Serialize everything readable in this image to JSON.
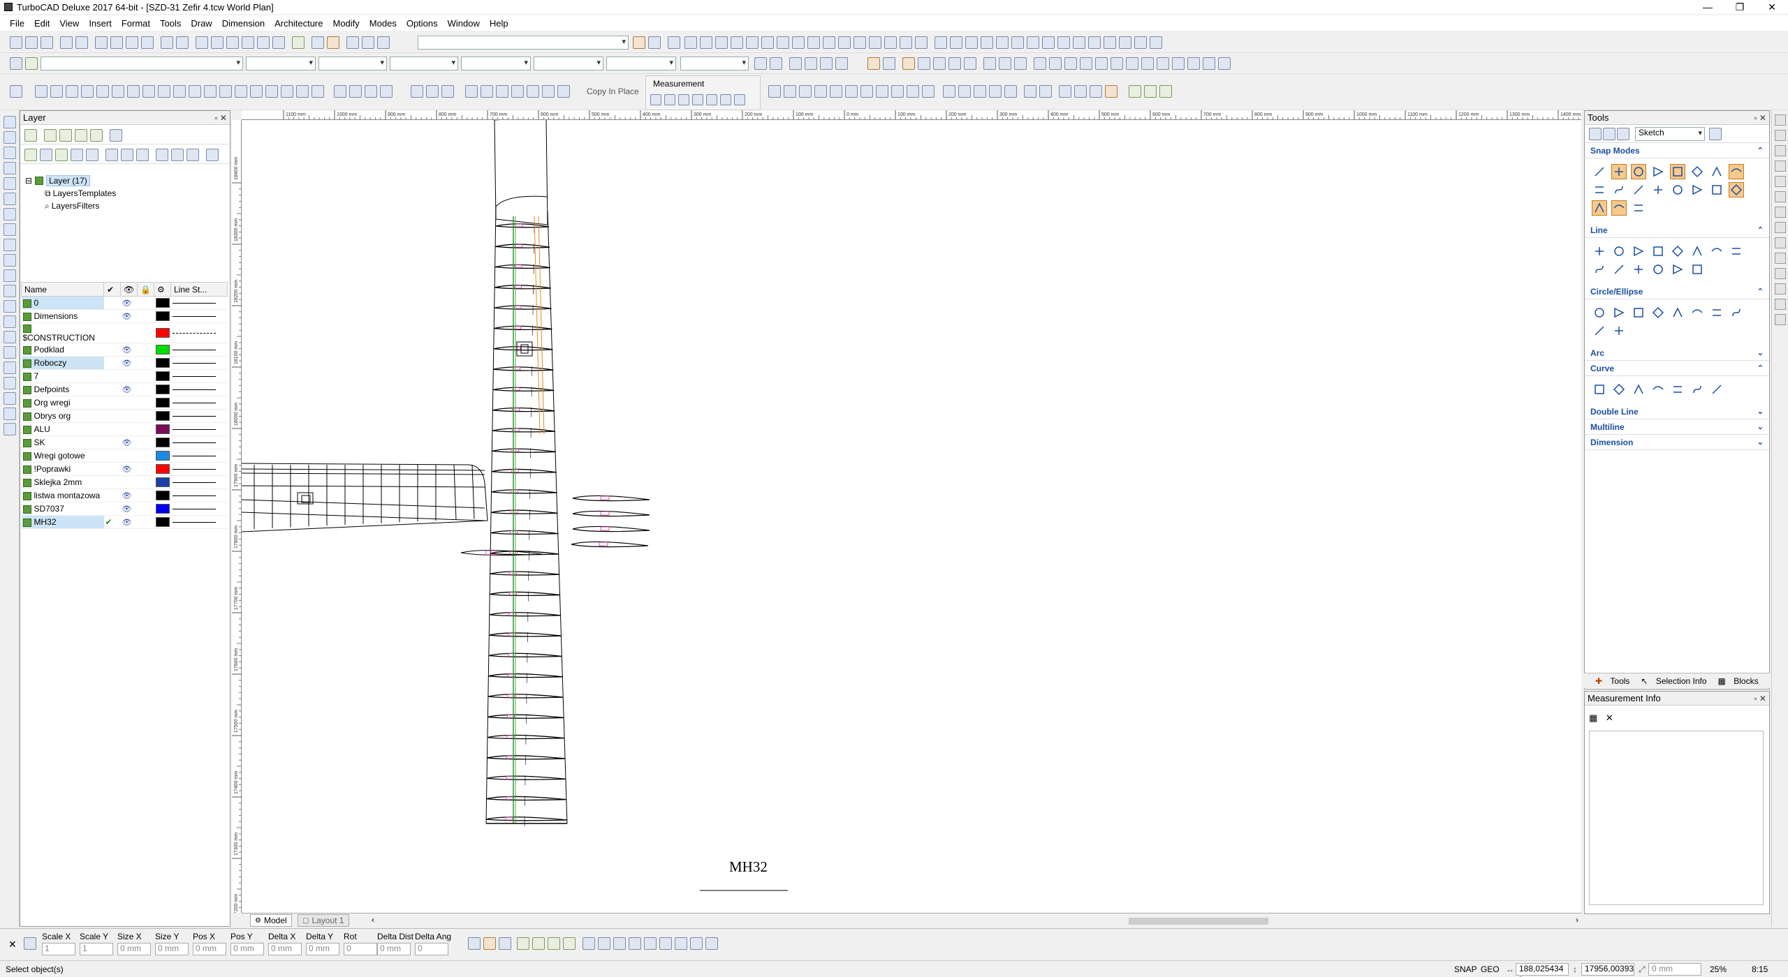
{
  "window": {
    "title": "TurboCAD Deluxe 2017 64-bit - [SZD-31 Zefir 4.tcw World Plan]",
    "controls": [
      "—",
      "❐",
      "✕"
    ]
  },
  "menu": [
    "File",
    "Edit",
    "View",
    "Insert",
    "Format",
    "Tools",
    "Draw",
    "Dimension",
    "Architecture",
    "Modify",
    "Modes",
    "Options",
    "Window",
    "Help"
  ],
  "toolbars": {
    "copy_in_place": "Copy In Place",
    "measurement_group": "Measurement"
  },
  "layer_panel": {
    "title": "Layer",
    "tree": {
      "root": "Layer (17)",
      "children": [
        "LayersTemplates",
        "LayersFilters"
      ]
    },
    "columns": [
      "Name",
      "✔",
      "👁",
      "🔒",
      "⚙",
      "Line St..."
    ],
    "layers": [
      {
        "name": "0",
        "visible": true,
        "active": false,
        "selected": true,
        "color": "#000000",
        "line": "solid"
      },
      {
        "name": "Dimensions",
        "visible": true,
        "active": false,
        "selected": false,
        "color": "#000000",
        "line": "solid"
      },
      {
        "name": "$CONSTRUCTION",
        "visible": false,
        "active": false,
        "selected": false,
        "color": "#ff0000",
        "line": "dash"
      },
      {
        "name": "Podklad",
        "visible": true,
        "active": false,
        "selected": false,
        "color": "#00dd00",
        "line": "solid"
      },
      {
        "name": "Roboczy",
        "visible": true,
        "active": false,
        "selected": true,
        "color": "#000000",
        "line": "solid"
      },
      {
        "name": "7",
        "visible": false,
        "active": false,
        "selected": false,
        "color": "#000000",
        "line": "solid"
      },
      {
        "name": "Defpoints",
        "visible": true,
        "active": false,
        "selected": false,
        "color": "#000000",
        "line": "solid"
      },
      {
        "name": "Org wregi",
        "visible": false,
        "active": false,
        "selected": false,
        "color": "#000000",
        "line": "solid"
      },
      {
        "name": "Obrys org",
        "visible": false,
        "active": false,
        "selected": false,
        "color": "#000000",
        "line": "solid"
      },
      {
        "name": "ALU",
        "visible": false,
        "active": false,
        "selected": false,
        "color": "#7a0a5a",
        "line": "solid"
      },
      {
        "name": "SK",
        "visible": true,
        "active": false,
        "selected": false,
        "color": "#000000",
        "line": "solid"
      },
      {
        "name": "Wregi gotowe",
        "visible": false,
        "active": false,
        "selected": false,
        "color": "#1e88e5",
        "line": "solid"
      },
      {
        "name": "!Poprawki",
        "visible": true,
        "active": false,
        "selected": false,
        "color": "#ff0000",
        "line": "solid"
      },
      {
        "name": "Sklejka 2mm",
        "visible": false,
        "active": false,
        "selected": false,
        "color": "#1a3fa8",
        "line": "solid"
      },
      {
        "name": "listwa montazowa",
        "visible": true,
        "active": false,
        "selected": false,
        "color": "#000000",
        "line": "solid"
      },
      {
        "name": "SD7037",
        "visible": true,
        "active": false,
        "selected": false,
        "color": "#0000ee",
        "line": "solid"
      },
      {
        "name": "MH32",
        "visible": true,
        "active": true,
        "selected": true,
        "color": "#000000",
        "line": "solid"
      }
    ]
  },
  "canvas": {
    "tabs": [
      "Model",
      "Layout 1"
    ],
    "label": "MH32",
    "ruler_top": [
      "1100 mm",
      "1000 mm",
      "900 mm",
      "800 mm",
      "700 mm",
      "600 mm",
      "500 mm",
      "400 mm",
      "300 mm",
      "200 mm",
      "100 mm",
      "0 mm",
      "100 mm",
      "200 mm",
      "300 mm",
      "400 mm",
      "500 mm",
      "600 mm",
      "700 mm",
      "800 mm",
      "900 mm",
      "1000 mm",
      "1100 mm",
      "1200 mm",
      "1300 mm",
      "1400 mm"
    ],
    "ruler_left": [
      "18400 mm",
      "18300 mm",
      "18200 mm",
      "18100 mm",
      "18000 mm",
      "17900 mm",
      "17800 mm",
      "17700 mm",
      "17600 mm",
      "17500 mm",
      "17400 mm",
      "17300 mm",
      "17200 mm"
    ]
  },
  "tools_panel": {
    "title": "Tools",
    "mode": "Sketch",
    "sections": [
      {
        "name": "Snap Modes",
        "expanded": true
      },
      {
        "name": "Line",
        "expanded": true
      },
      {
        "name": "Circle/Ellipse",
        "expanded": true
      },
      {
        "name": "Arc",
        "expanded": false
      },
      {
        "name": "Curve",
        "expanded": true
      },
      {
        "name": "Double Line",
        "expanded": false
      },
      {
        "name": "Multiline",
        "expanded": false
      },
      {
        "name": "Dimension",
        "expanded": false
      }
    ],
    "bottom_tabs": [
      "Tools",
      "Selection Info",
      "Blocks"
    ]
  },
  "measurement_info": {
    "title": "Measurement Info"
  },
  "inspector": {
    "fields": [
      {
        "label": "Scale X",
        "value": "1"
      },
      {
        "label": "Scale Y",
        "value": "1"
      },
      {
        "label": "Size X",
        "value": "0 mm"
      },
      {
        "label": "Size Y",
        "value": "0 mm"
      },
      {
        "label": "Pos X",
        "value": "0 mm"
      },
      {
        "label": "Pos Y",
        "value": "0 mm"
      },
      {
        "label": "Delta X",
        "value": "0 mm"
      },
      {
        "label": "Delta Y",
        "value": "0 mm"
      },
      {
        "label": "Rot",
        "value": "0"
      },
      {
        "label": "Delta Dist",
        "value": "0 mm"
      },
      {
        "label": "Delta Ang",
        "value": "0"
      }
    ]
  },
  "status": {
    "message": "Select object(s)",
    "snap": "SNAP",
    "geo": "GEO",
    "x": "188,025434 r",
    "y": "17956,00393",
    "z": "0 mm",
    "zoom": "25%",
    "time": "8:15"
  }
}
